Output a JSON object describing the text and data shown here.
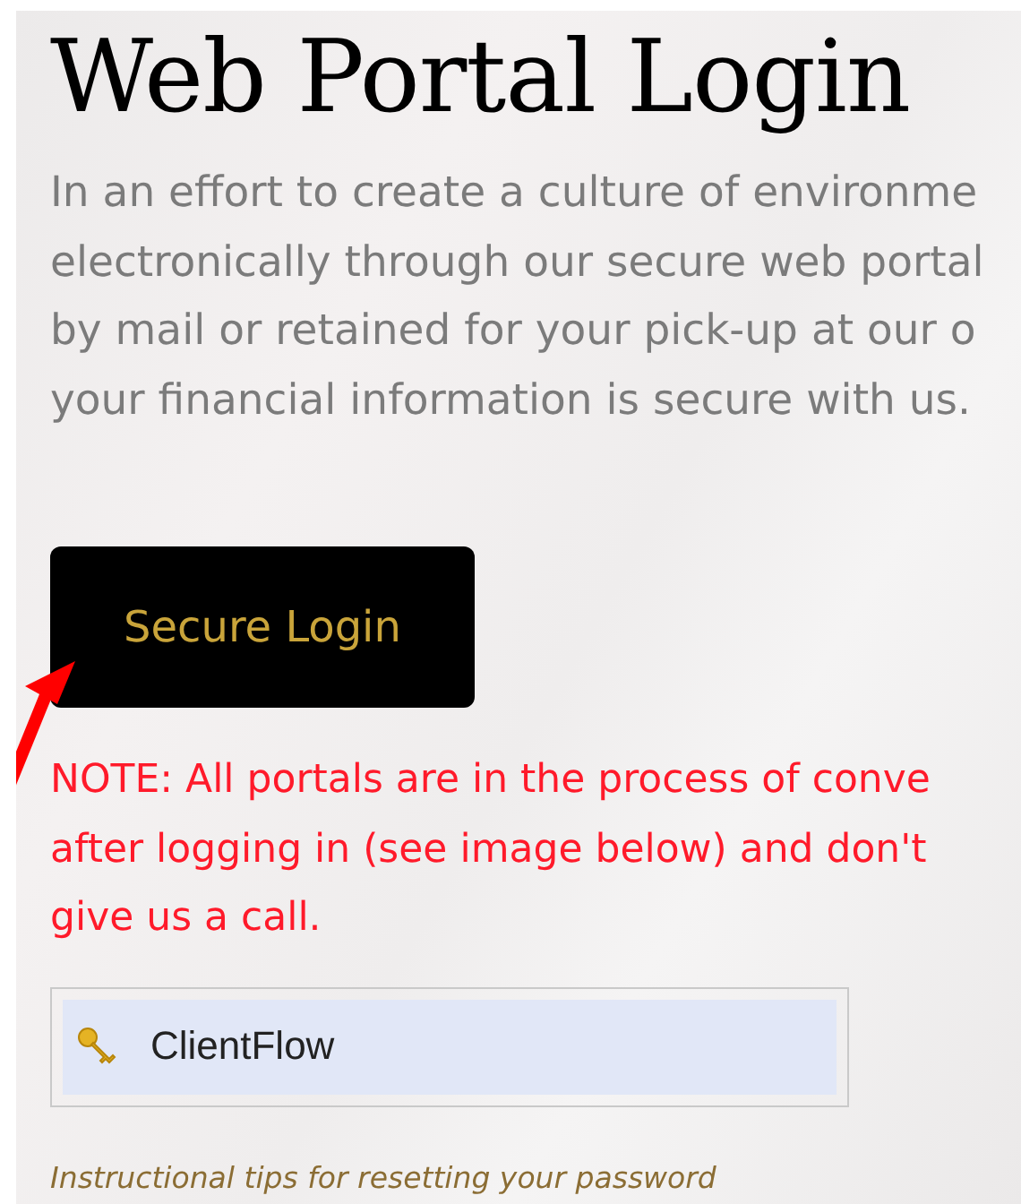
{
  "title": "Web Portal Login",
  "intro_lines": [
    "In an effort to create a culture of environme",
    "electronically through our secure web portal",
    "by mail or retained for your pick-up at our o",
    "your financial information is secure with us."
  ],
  "login_button": "Secure Login",
  "note_lines": [
    "NOTE: All portals are in the process of conve",
    "after logging in (see image below) and don't",
    "give us a call."
  ],
  "portal_link": "ClientFlow",
  "caption": "Instructional tips for resetting your password"
}
